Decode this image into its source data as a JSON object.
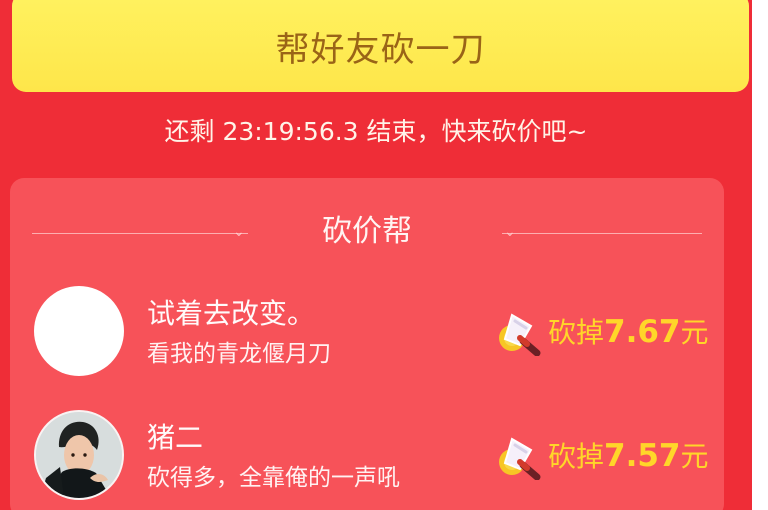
{
  "page": {
    "cta_label": "帮好友砍一刀",
    "countdown_text": "还剩 23:19:56.3 结束，快来砍价吧~"
  },
  "helpers": {
    "title": "砍价帮",
    "items": [
      {
        "name": "试着去改变。",
        "message": "看我的青龙偃月刀",
        "cut_prefix": "砍掉",
        "cut_value": "7.67",
        "cut_unit": "元",
        "avatar_type": "blank"
      },
      {
        "name": "猪二",
        "message": "砍得多，全靠俺的一声吼",
        "cut_prefix": "砍掉",
        "cut_value": "7.57",
        "cut_unit": "元",
        "avatar_type": "photo"
      }
    ]
  },
  "colors": {
    "background_red": "#ef2d37",
    "card_red": "#f75259",
    "button_yellow": "#fee64a",
    "button_text": "#9a6417",
    "amount_yellow": "#ffd629"
  },
  "icons": {
    "cut_icon": "cleaver-coin-icon",
    "avatar_placeholder": "blank-avatar-icon"
  }
}
